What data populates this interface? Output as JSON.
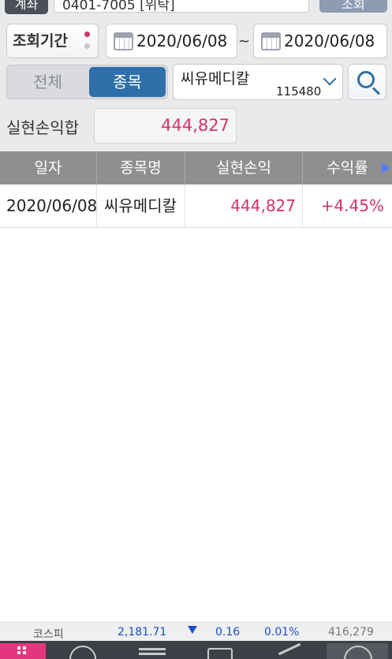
{
  "account": {
    "label": "계좌",
    "value": "0401-7005 [위탁]",
    "right_button": "조회"
  },
  "filter": {
    "period_button": "조회기간",
    "period_dot_colors": [
      "#d0306a",
      "#c3c7ce"
    ],
    "start_date": "2020/06/08",
    "date_separator": "~",
    "end_date": "2020/06/08",
    "segment_all": "전체",
    "segment_stock": "종목",
    "segment_selected": "종목",
    "stock_name": "씨유메디칼",
    "stock_code": "115480",
    "search_icon": "search-icon"
  },
  "summary": {
    "label": "실현손익합",
    "value": "444,827"
  },
  "table": {
    "headers": [
      "일자",
      "종목명",
      "실현손익",
      "수익률"
    ],
    "rows": [
      {
        "date": "2020/06/08",
        "name": "씨유메디칼",
        "profit": "444,827",
        "rate": "+4.45%"
      }
    ]
  },
  "ticker": {
    "index_name": "코스피",
    "index_value": "2,181.71",
    "change": "0.16",
    "change_pct": "0.01%",
    "volume": "416,279"
  },
  "colors": {
    "accent_blue": "#2d6fa8",
    "profit_pink": "#d3336b",
    "header_gray": "#8e8f91",
    "nav_active": "#e6357f"
  }
}
